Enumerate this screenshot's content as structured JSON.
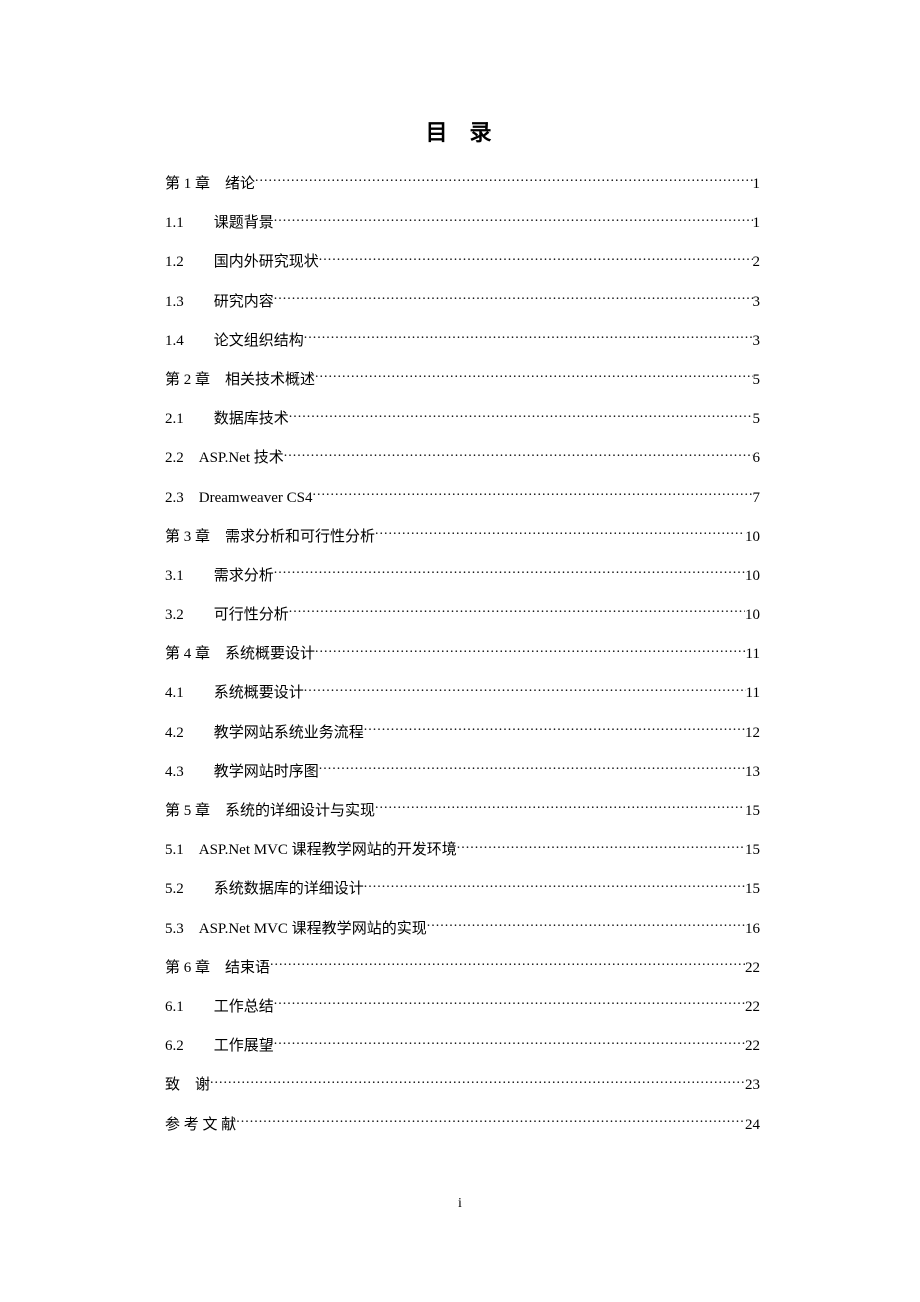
{
  "title": "目 录",
  "pageNumber": "i",
  "entries": [
    {
      "label": "第 1 章　绪论 ",
      "page": "1"
    },
    {
      "label": "1.1　　课题背景 ",
      "page": "1"
    },
    {
      "label": "1.2　　国内外研究现状 ",
      "page": "2"
    },
    {
      "label": "1.3　　研究内容 ",
      "page": "3"
    },
    {
      "label": "1.4　　论文组织结构 ",
      "page": "3"
    },
    {
      "label": "第 2 章　相关技术概述 ",
      "page": "5"
    },
    {
      "label": "2.1　　数据库技术 ",
      "page": "5"
    },
    {
      "label": "2.2　ASP.Net 技术 ",
      "page": "6"
    },
    {
      "label": "2.3　Dreamweaver CS4 ",
      "page": "7"
    },
    {
      "label": "第 3 章　需求分析和可行性分析 ",
      "page": "10"
    },
    {
      "label": "3.1　　需求分析 ",
      "page": "10"
    },
    {
      "label": "3.2　　可行性分析 ",
      "page": "10"
    },
    {
      "label": "第 4 章　系统概要设计 ",
      "page": "11"
    },
    {
      "label": "4.1　　系统概要设计 ",
      "page": "11"
    },
    {
      "label": "4.2　　教学网站系统业务流程 ",
      "page": "12"
    },
    {
      "label": "4.3　　教学网站时序图 ",
      "page": "13"
    },
    {
      "label": "第 5 章　系统的详细设计与实现 ",
      "page": "15"
    },
    {
      "label": "5.1　ASP.Net MVC 课程教学网站的开发环境 ",
      "page": "15"
    },
    {
      "label": "5.2　　系统数据库的详细设计 ",
      "page": "15"
    },
    {
      "label": "5.3　ASP.Net MVC 课程教学网站的实现 ",
      "page": "16"
    },
    {
      "label": "第 6 章　结束语 ",
      "page": "22"
    },
    {
      "label": "6.1　　工作总结 ",
      "page": "22"
    },
    {
      "label": "6.2　　工作展望 ",
      "page": "22"
    },
    {
      "label": "致　谢",
      "page": "23"
    },
    {
      "label": "参 考 文 献",
      "page": "24"
    }
  ]
}
